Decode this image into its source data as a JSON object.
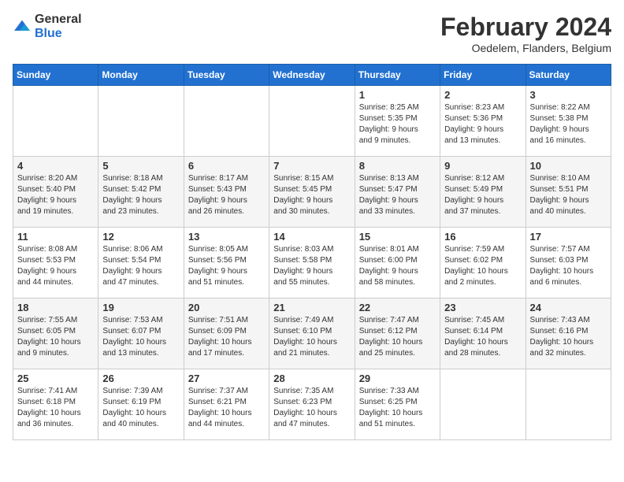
{
  "header": {
    "logo_line1": "General",
    "logo_line2": "Blue",
    "month_year": "February 2024",
    "location": "Oedelem, Flanders, Belgium"
  },
  "days_of_week": [
    "Sunday",
    "Monday",
    "Tuesday",
    "Wednesday",
    "Thursday",
    "Friday",
    "Saturday"
  ],
  "weeks": [
    [
      {
        "day": "",
        "info": ""
      },
      {
        "day": "",
        "info": ""
      },
      {
        "day": "",
        "info": ""
      },
      {
        "day": "",
        "info": ""
      },
      {
        "day": "1",
        "info": "Sunrise: 8:25 AM\nSunset: 5:35 PM\nDaylight: 9 hours\nand 9 minutes."
      },
      {
        "day": "2",
        "info": "Sunrise: 8:23 AM\nSunset: 5:36 PM\nDaylight: 9 hours\nand 13 minutes."
      },
      {
        "day": "3",
        "info": "Sunrise: 8:22 AM\nSunset: 5:38 PM\nDaylight: 9 hours\nand 16 minutes."
      }
    ],
    [
      {
        "day": "4",
        "info": "Sunrise: 8:20 AM\nSunset: 5:40 PM\nDaylight: 9 hours\nand 19 minutes."
      },
      {
        "day": "5",
        "info": "Sunrise: 8:18 AM\nSunset: 5:42 PM\nDaylight: 9 hours\nand 23 minutes."
      },
      {
        "day": "6",
        "info": "Sunrise: 8:17 AM\nSunset: 5:43 PM\nDaylight: 9 hours\nand 26 minutes."
      },
      {
        "day": "7",
        "info": "Sunrise: 8:15 AM\nSunset: 5:45 PM\nDaylight: 9 hours\nand 30 minutes."
      },
      {
        "day": "8",
        "info": "Sunrise: 8:13 AM\nSunset: 5:47 PM\nDaylight: 9 hours\nand 33 minutes."
      },
      {
        "day": "9",
        "info": "Sunrise: 8:12 AM\nSunset: 5:49 PM\nDaylight: 9 hours\nand 37 minutes."
      },
      {
        "day": "10",
        "info": "Sunrise: 8:10 AM\nSunset: 5:51 PM\nDaylight: 9 hours\nand 40 minutes."
      }
    ],
    [
      {
        "day": "11",
        "info": "Sunrise: 8:08 AM\nSunset: 5:53 PM\nDaylight: 9 hours\nand 44 minutes."
      },
      {
        "day": "12",
        "info": "Sunrise: 8:06 AM\nSunset: 5:54 PM\nDaylight: 9 hours\nand 47 minutes."
      },
      {
        "day": "13",
        "info": "Sunrise: 8:05 AM\nSunset: 5:56 PM\nDaylight: 9 hours\nand 51 minutes."
      },
      {
        "day": "14",
        "info": "Sunrise: 8:03 AM\nSunset: 5:58 PM\nDaylight: 9 hours\nand 55 minutes."
      },
      {
        "day": "15",
        "info": "Sunrise: 8:01 AM\nSunset: 6:00 PM\nDaylight: 9 hours\nand 58 minutes."
      },
      {
        "day": "16",
        "info": "Sunrise: 7:59 AM\nSunset: 6:02 PM\nDaylight: 10 hours\nand 2 minutes."
      },
      {
        "day": "17",
        "info": "Sunrise: 7:57 AM\nSunset: 6:03 PM\nDaylight: 10 hours\nand 6 minutes."
      }
    ],
    [
      {
        "day": "18",
        "info": "Sunrise: 7:55 AM\nSunset: 6:05 PM\nDaylight: 10 hours\nand 9 minutes."
      },
      {
        "day": "19",
        "info": "Sunrise: 7:53 AM\nSunset: 6:07 PM\nDaylight: 10 hours\nand 13 minutes."
      },
      {
        "day": "20",
        "info": "Sunrise: 7:51 AM\nSunset: 6:09 PM\nDaylight: 10 hours\nand 17 minutes."
      },
      {
        "day": "21",
        "info": "Sunrise: 7:49 AM\nSunset: 6:10 PM\nDaylight: 10 hours\nand 21 minutes."
      },
      {
        "day": "22",
        "info": "Sunrise: 7:47 AM\nSunset: 6:12 PM\nDaylight: 10 hours\nand 25 minutes."
      },
      {
        "day": "23",
        "info": "Sunrise: 7:45 AM\nSunset: 6:14 PM\nDaylight: 10 hours\nand 28 minutes."
      },
      {
        "day": "24",
        "info": "Sunrise: 7:43 AM\nSunset: 6:16 PM\nDaylight: 10 hours\nand 32 minutes."
      }
    ],
    [
      {
        "day": "25",
        "info": "Sunrise: 7:41 AM\nSunset: 6:18 PM\nDaylight: 10 hours\nand 36 minutes."
      },
      {
        "day": "26",
        "info": "Sunrise: 7:39 AM\nSunset: 6:19 PM\nDaylight: 10 hours\nand 40 minutes."
      },
      {
        "day": "27",
        "info": "Sunrise: 7:37 AM\nSunset: 6:21 PM\nDaylight: 10 hours\nand 44 minutes."
      },
      {
        "day": "28",
        "info": "Sunrise: 7:35 AM\nSunset: 6:23 PM\nDaylight: 10 hours\nand 47 minutes."
      },
      {
        "day": "29",
        "info": "Sunrise: 7:33 AM\nSunset: 6:25 PM\nDaylight: 10 hours\nand 51 minutes."
      },
      {
        "day": "",
        "info": ""
      },
      {
        "day": "",
        "info": ""
      }
    ]
  ]
}
